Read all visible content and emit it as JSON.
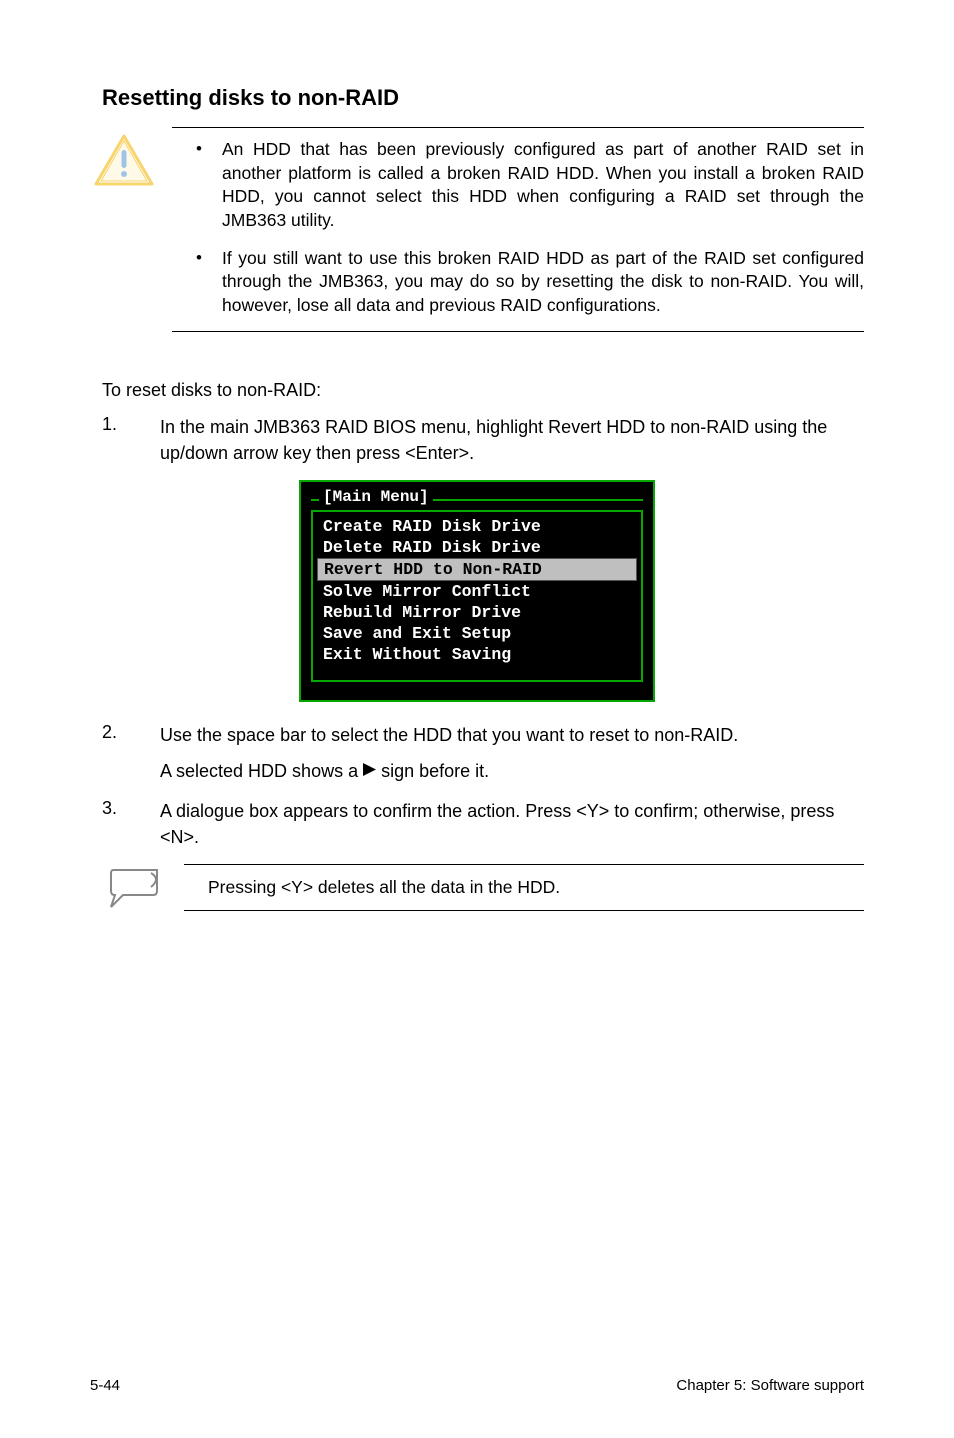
{
  "heading": "Resetting disks to non-RAID",
  "caution_bullets": [
    "An HDD that has been previously configured as part of another RAID set in another platform is called a broken RAID HDD. When you install a broken RAID HDD, you cannot select this HDD when configuring a RAID set through the JMB363 utility.",
    "If you still want to use this broken RAID HDD as part of the RAID set configured through the JMB363, you may do so by resetting the disk to non-RAID. You will, however, lose all data and previous RAID configurations."
  ],
  "reset_intro": "To reset disks to non-RAID:",
  "steps": [
    {
      "num": "1.",
      "text": "In the main JMB363 RAID BIOS menu, highlight Revert HDD to non-RAID using the up/down arrow key then press <Enter>."
    },
    {
      "num": "2.",
      "text": "Use the space bar to select the HDD that you want to reset to non-RAID.",
      "sub_before": "A selected HDD shows a",
      "sub_after": "sign before it."
    },
    {
      "num": "3.",
      "text": "A dialogue box appears to confirm the action. Press <Y> to confirm; otherwise, press <N>."
    }
  ],
  "menu": {
    "title": "[Main Menu]",
    "items": [
      {
        "label": "Create RAID Disk Drive",
        "selected": false
      },
      {
        "label": "Delete RAID Disk Drive",
        "selected": false
      },
      {
        "label": "Revert HDD to Non-RAID",
        "selected": true
      },
      {
        "label": "Solve Mirror Conflict",
        "selected": false
      },
      {
        "label": "Rebuild Mirror Drive",
        "selected": false
      },
      {
        "label": "Save and Exit Setup",
        "selected": false
      },
      {
        "label": "Exit Without Saving",
        "selected": false
      }
    ]
  },
  "note_text": "Pressing <Y> deletes all the data in the HDD.",
  "footer_left": "5-44",
  "footer_right": "Chapter 5: Software support"
}
